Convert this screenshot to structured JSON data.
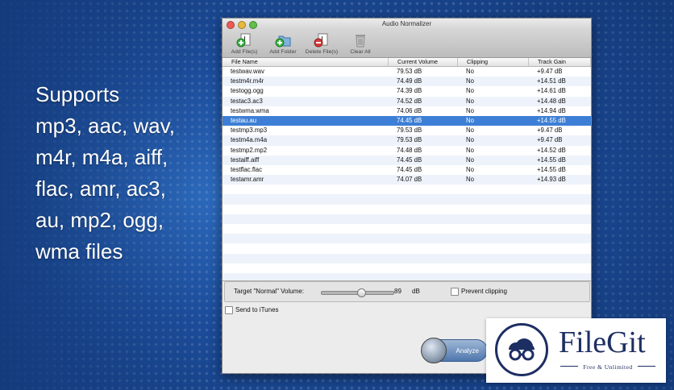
{
  "promo": {
    "lines": [
      "Supports",
      "mp3, aac, wav,",
      "m4r, m4a, aiff,",
      "flac, amr, ac3,",
      "au, mp2, ogg,",
      "wma files"
    ]
  },
  "window": {
    "title": "Audio Normalizer",
    "toolbar": {
      "add_files": "Add File(s)",
      "add_folder": "Add Folder",
      "delete_files": "Delete File(s)",
      "clear_all": "Clear All"
    },
    "table": {
      "columns": [
        "File Name",
        "Current Volume",
        "Clipping",
        "Track Gain"
      ],
      "rows": [
        [
          "testwav.wav",
          "79.53 dB",
          "No",
          "+9.47 dB"
        ],
        [
          "testm4r.m4r",
          "74.49 dB",
          "No",
          "+14.51 dB"
        ],
        [
          "testogg.ogg",
          "74.39 dB",
          "No",
          "+14.61 dB"
        ],
        [
          "testac3.ac3",
          "74.52 dB",
          "No",
          "+14.48 dB"
        ],
        [
          "testwma.wma",
          "74.06 dB",
          "No",
          "+14.94 dB"
        ],
        [
          "testau.au",
          "74.45 dB",
          "No",
          "+14.55 dB"
        ],
        [
          "testmp3.mp3",
          "79.53 dB",
          "No",
          "+9.47 dB"
        ],
        [
          "testm4a.m4a",
          "79.53 dB",
          "No",
          "+9.47 dB"
        ],
        [
          "testmp2.mp2",
          "74.48 dB",
          "No",
          "+14.52 dB"
        ],
        [
          "testaiff.aiff",
          "74.45 dB",
          "No",
          "+14.55 dB"
        ],
        [
          "testflac.flac",
          "74.45 dB",
          "No",
          "+14.55 dB"
        ],
        [
          "testamr.amr",
          "74.07 dB",
          "No",
          "+14.93 dB"
        ]
      ],
      "selected_row": 5
    },
    "volume": {
      "label": "Target \"Normal\" Volume:",
      "value": "89",
      "unit": "dB",
      "slider_fraction": 0.55,
      "prevent_clipping_label": "Prevent clipping"
    },
    "send_to_itunes_label": "Send to iTunes",
    "analyze_label": "Analyze"
  },
  "badge": {
    "name": "FileGit",
    "tagline": "Free & Unlimited"
  },
  "colors": {
    "selection": "#3d7fd6",
    "brand": "#1d2e63"
  }
}
